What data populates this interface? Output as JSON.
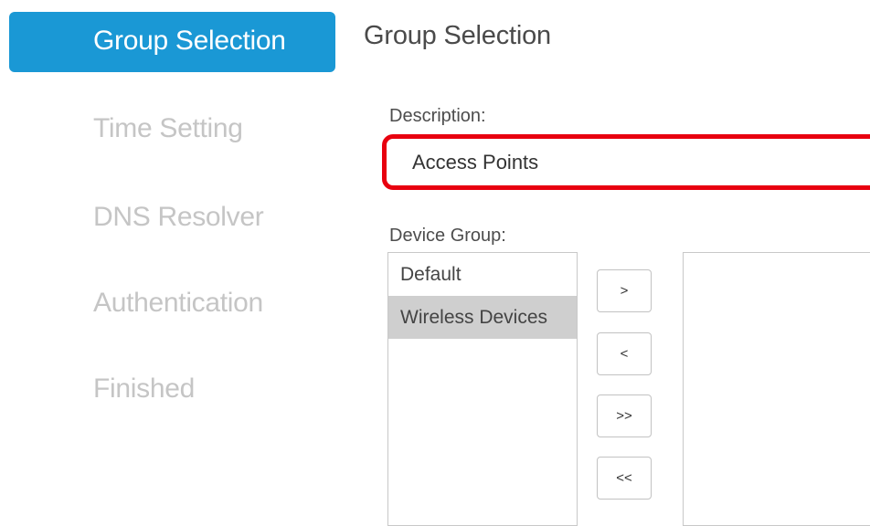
{
  "sidebar": {
    "active_step": "Group Selection",
    "steps": [
      {
        "label": "Time Setting"
      },
      {
        "label": "DNS Resolver"
      },
      {
        "label": "Authentication"
      },
      {
        "label": "Finished"
      }
    ]
  },
  "main": {
    "title": "Group Selection",
    "description": {
      "label": "Description:",
      "value": "Access Points"
    },
    "device_group": {
      "label": "Device Group:",
      "available": [
        "Default",
        "Wireless Devices"
      ],
      "selected_item": "Wireless Devices",
      "chosen": []
    },
    "buttons": {
      "add_one": ">",
      "remove_one": "<",
      "add_all": ">>",
      "remove_all": "<<"
    }
  },
  "colors": {
    "accent": "#1a98d5",
    "highlight_border": "#e8000f",
    "inactive_step_text": "#c5c5c5",
    "selected_row": "#cfcfcf"
  }
}
